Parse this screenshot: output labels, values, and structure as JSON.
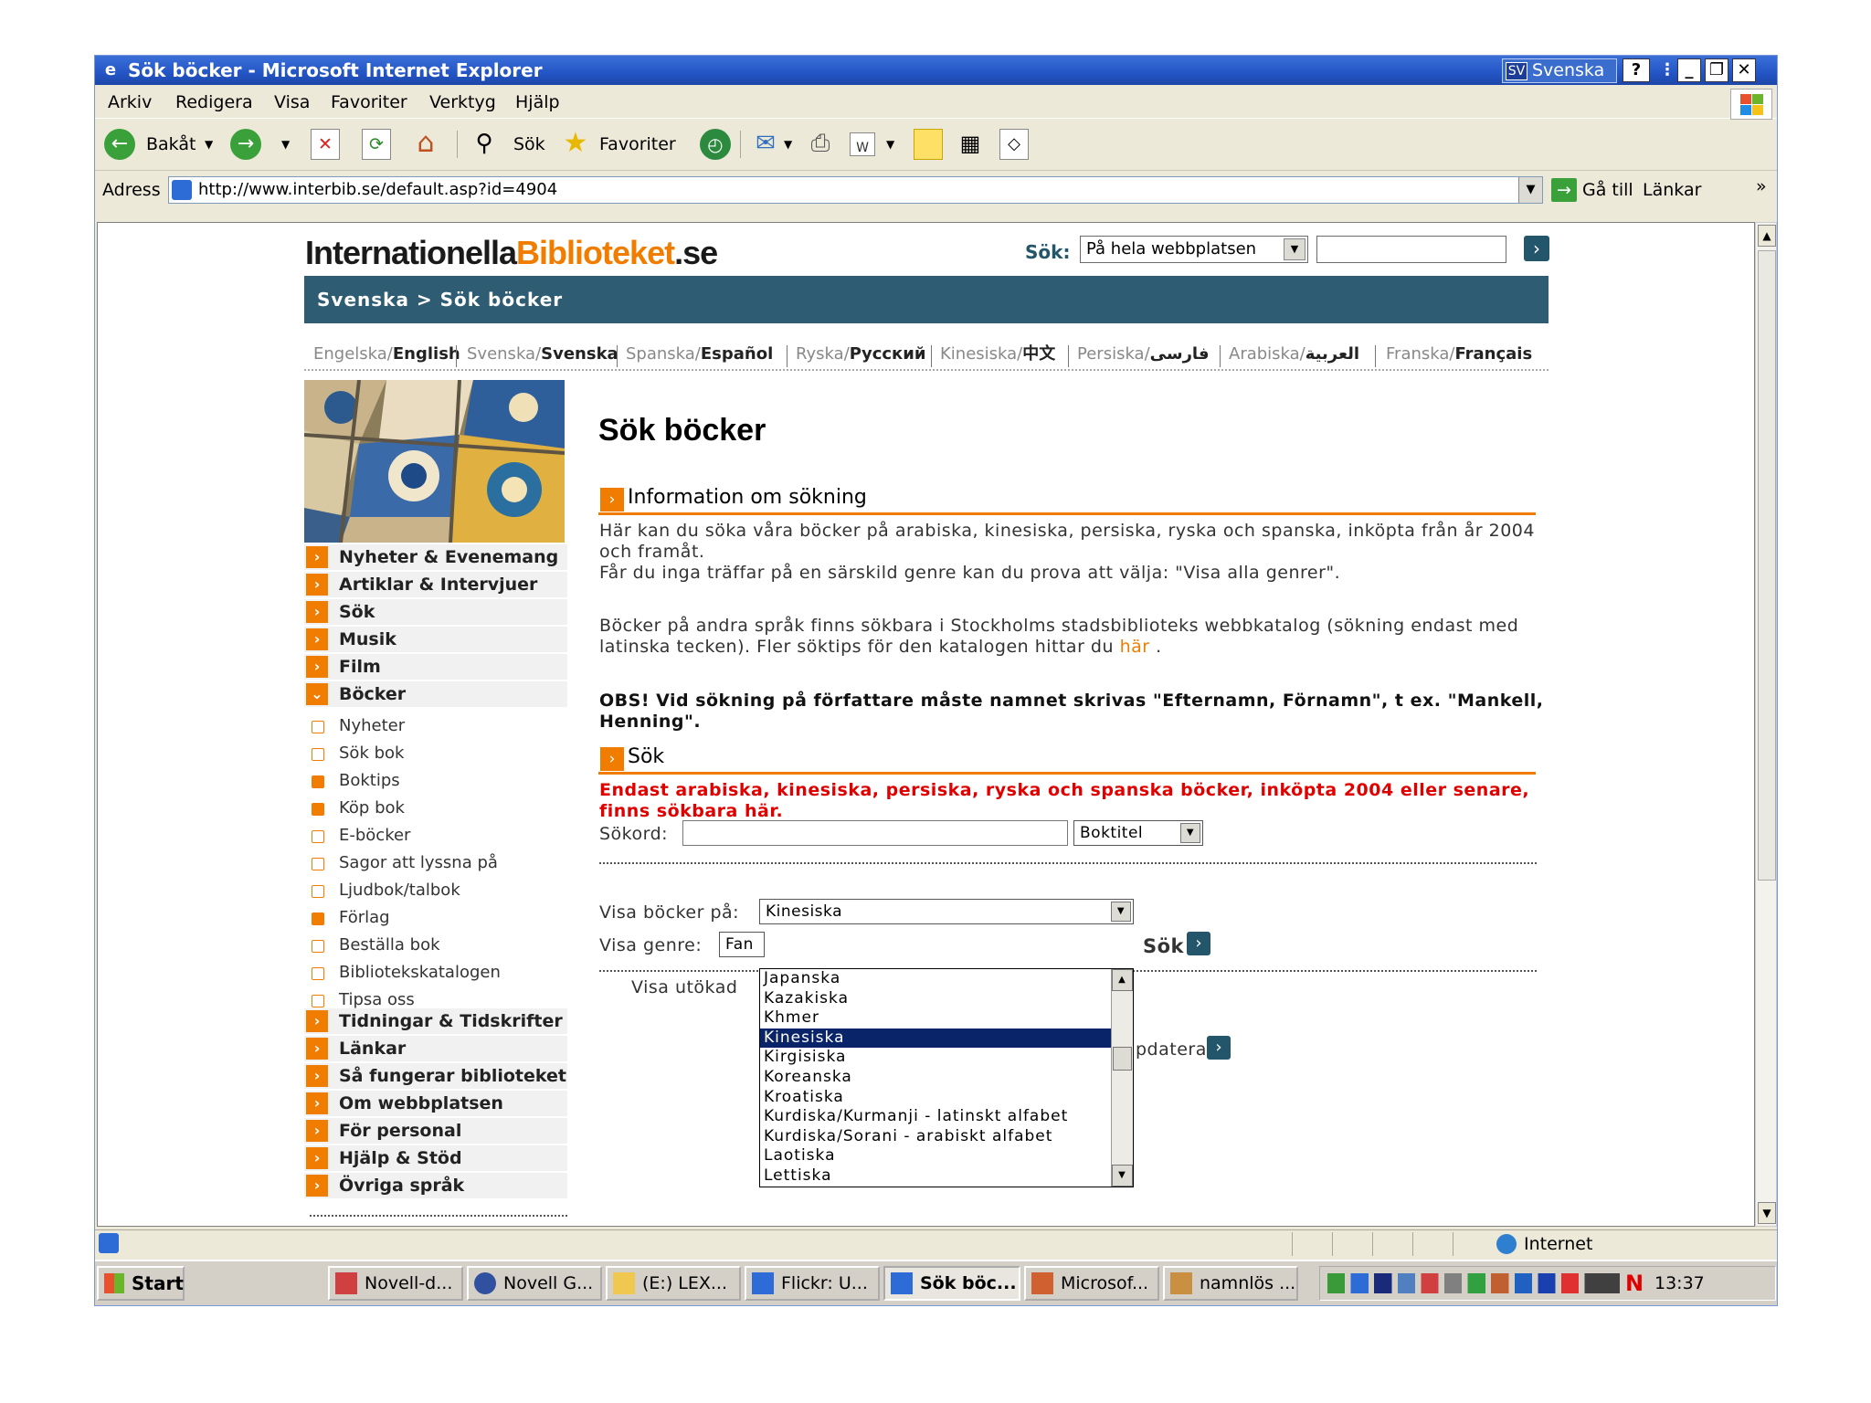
{
  "window": {
    "title": "Sök böcker - Microsoft Internet Explorer",
    "language_code": "SV",
    "language_label": "Svenska",
    "help_glyph": "?"
  },
  "menu": [
    "Arkiv",
    "Redigera",
    "Visa",
    "Favoriter",
    "Verktyg",
    "Hjälp"
  ],
  "toolbar": {
    "back_label": "Bakåt",
    "search_label": "Sök",
    "favorites_label": "Favoriter"
  },
  "address": {
    "label": "Adress",
    "url": "http://www.interbib.se/default.asp?id=4904",
    "go_label": "Gå till",
    "links_label": "Länkar"
  },
  "page": {
    "logo": {
      "part1": "Internationella",
      "part2": "Biblioteket",
      "part3": ".se"
    },
    "site_search": {
      "label": "Sök:",
      "scope": "På hela webbplatsen",
      "value": ""
    },
    "breadcrumb": "Svenska > Sök böcker",
    "languages": [
      {
        "swe": "Engelska/",
        "native": "English"
      },
      {
        "swe": "Svenska/",
        "native": "Svenska"
      },
      {
        "swe": "Spanska/",
        "native": "Español"
      },
      {
        "swe": "Ryska/",
        "native": "Русский"
      },
      {
        "swe": "Kinesiska/",
        "native": "中文"
      },
      {
        "swe": "Persiska/",
        "native": "فارسی"
      },
      {
        "swe": "Arabiska/",
        "native": "العربية"
      },
      {
        "swe": "Franska/",
        "native": "Français"
      }
    ],
    "nav_main_top": [
      {
        "label": "Nyheter & Evenemang"
      },
      {
        "label": "Artiklar & Intervjuer"
      },
      {
        "label": "Sök"
      },
      {
        "label": "Musik"
      },
      {
        "label": "Film"
      },
      {
        "label": "Böcker"
      }
    ],
    "nav_sub": [
      {
        "label": "Nyheter"
      },
      {
        "label": "Sök bok"
      },
      {
        "label": "Boktips"
      },
      {
        "label": "Köp bok"
      },
      {
        "label": "E-böcker"
      },
      {
        "label": "Sagor att lyssna på"
      },
      {
        "label": "Ljudbok/talbok"
      },
      {
        "label": "Förlag"
      },
      {
        "label": "Beställa bok"
      },
      {
        "label": "Bibliotekskatalogen"
      },
      {
        "label": "Tipsa oss"
      }
    ],
    "nav_main_bottom": [
      {
        "label": "Tidningar & Tidskrifter"
      },
      {
        "label": "Länkar"
      },
      {
        "label": "Så fungerar biblioteket"
      },
      {
        "label": "Om webbplatsen"
      },
      {
        "label": "För personal"
      },
      {
        "label": "Hjälp & Stöd"
      },
      {
        "label": "Övriga språk"
      }
    ],
    "heading": "Sök böcker",
    "info_heading": "Information om sökning",
    "info_p1": "Här kan du söka våra böcker på arabiska, kinesiska, persiska, ryska och spanska, inköpta från år 2004 och framåt.",
    "info_p2": "Får du inga träffar på en särskild genre kan du prova att välja: \"Visa alla genrer\".",
    "info_p3_a": "Böcker på andra språk finns sökbara i Stockholms stadsbiblioteks webbkatalog (sökning endast med latinska tecken). Fler söktips för den katalogen hittar du",
    "info_p3_link": "här",
    "info_p3_b": ".",
    "info_p4": "OBS! Vid sökning på författare måste namnet skrivas \"Efternamn, Förnamn\", t ex. \"Mankell, Henning\".",
    "search_heading": "Sök",
    "search_notice": "Endast arabiska, kinesiska, persiska, ryska och spanska böcker, inköpta 2004 eller senare, finns sökbara här.",
    "sokord_label": "Sökord:",
    "sokord_value": "",
    "field_select": "Boktitel",
    "visa_bocker_label": "Visa böcker på:",
    "visa_bocker_value": "Kinesiska",
    "visa_genre_label": "Visa genre:",
    "visa_genre_value": "Fan",
    "sok_button": "Sök",
    "visa_utokad": "Visa utökad",
    "uppdatera_partial": "pdatera",
    "dropdown_options": [
      "Japanska",
      "Kazakiska",
      "Khmer",
      "Kinesiska",
      "Kirgisiska",
      "Koreanska",
      "Kroatiska",
      "Kurdiska/Kurmanji - latinskt alfabet",
      "Kurdiska/Sorani - arabiskt alfabet",
      "Laotiska",
      "Lettiska"
    ],
    "dropdown_selected": "Kinesiska"
  },
  "status": {
    "zone": "Internet"
  },
  "taskbar": {
    "start": "Start",
    "tasks": [
      "Novell-d...",
      "Novell G...",
      "(E:) LEX...",
      "Flickr: U...",
      "Sök böc...",
      "Microsof...",
      "namnlös ..."
    ],
    "clock": "13:37"
  },
  "colors": {
    "accent": "#f07d00",
    "header_bar": "#2e5c72",
    "xp_title": "#2455c5"
  }
}
